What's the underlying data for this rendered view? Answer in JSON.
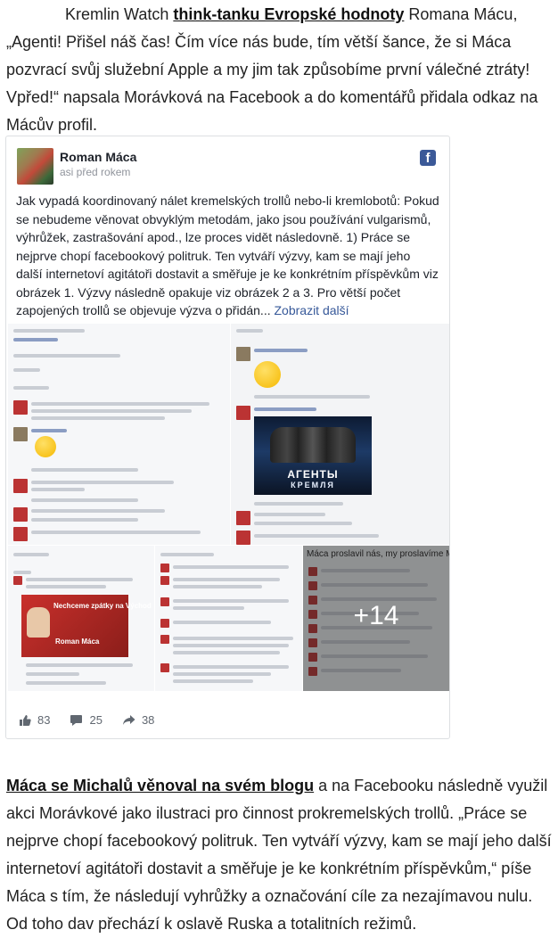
{
  "article": {
    "para1": {
      "intro": "Kremlin Watch ",
      "link": "think-tanku Evropské hodnoty",
      "rest": " Romana Mácu, „Agenti! Přišel náš čas! Čím více nás bude, tím větší šance, že si Máca pozvrací svůj služební Apple a my jim tak způsobíme první válečné ztráty! Vpřed!“ napsala Morávková na Facebook a do komentářů přidala odkaz na Mácův profil."
    },
    "para2": {
      "link": "Máca se Michalů věnoval na svém blogu",
      "rest": " a na Facebooku následně využil akci Morávkové jako ilustraci pro činnost prokremelských trollů. „Práce se nejprve chopí facebookový politruk. Ten vytváří výzvy, kam se mají jeho další internetoví agitátoři dostavit a směřuje je ke konkrétním příspěvkům,“ píše Máca s tím, že následují vyhrůžky a označování cíle za nezajímavou nulu. Od toho dav přechází k oslavě Ruska a totalitních režimů."
    }
  },
  "post": {
    "author": "Roman Máca",
    "time": "asi před rokem",
    "text": "Jak vypadá koordinovaný nálet kremelských trollů nebo-li kremlobotů: Pokud se nebudeme věnovat obvyklým metodám, jako jsou používání vulgarismů, výhrůžek, zastrašování apod., lze proces vidět následovně. 1) Práce se nejprve chopí facebookový politruk. Ten vytváří výzvy, kam se mají jeho další internetoví agitátoři dostavit a směřuje je ke konkrétním příspěvkům viz obrázek 1. Výzvy následně opakuje viz obrázek 2 a 3. Pro větší počet zapojených trollů se objevuje výzva o přidán...",
    "more": "Zobrazit další",
    "photos": {
      "agents_title": "АГЕНТЫ",
      "agents_sub": "КРЕМЛЯ",
      "banner_title": "Nechceme zpátky na Východ",
      "banner_name": "Roman Máca",
      "im5_title": "Máca proslavil nás, my proslavíme Mácu.",
      "more_count": "+14"
    },
    "stats": {
      "likes": "83",
      "comments": "25",
      "shares": "38"
    }
  }
}
